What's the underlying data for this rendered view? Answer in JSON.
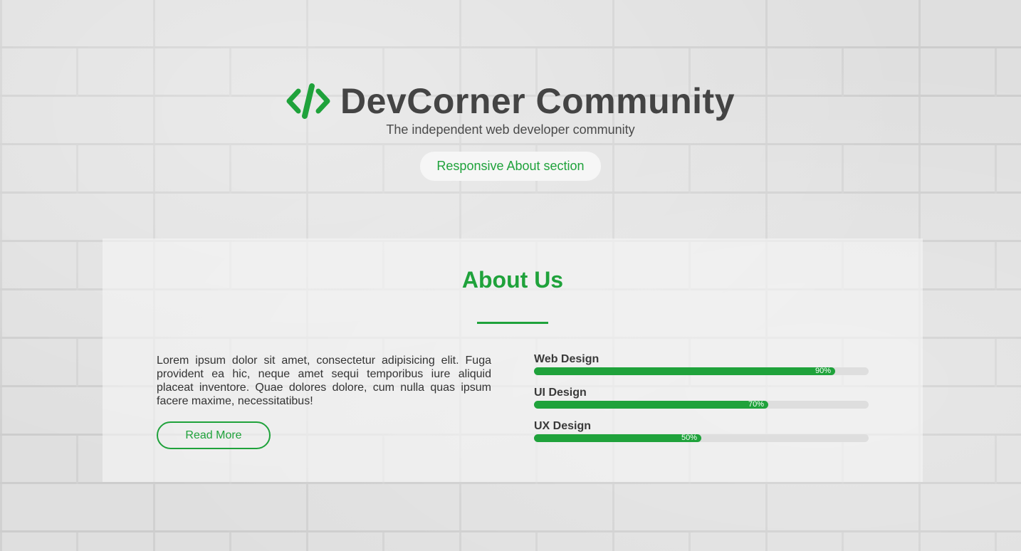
{
  "hero": {
    "title": "DevCorner Community",
    "tagline": "The independent web developer community",
    "button_label": "Responsive About section"
  },
  "about": {
    "title": "About Us",
    "text": "Lorem ipsum dolor sit amet, consectetur adipisicing elit. Fuga provident ea hic, neque amet sequi temporibus iure aliquid placeat inventore. Quae dolores dolore, cum nulla quas ipsum facere maxime, necessitatibus!",
    "read_more_label": "Read More"
  },
  "skills": [
    {
      "label": "Web Design",
      "percent": 90,
      "percent_label": "90%"
    },
    {
      "label": "UI Design",
      "percent": 70,
      "percent_label": "70%"
    },
    {
      "label": "UX Design",
      "percent": 50,
      "percent_label": "50%"
    }
  ],
  "colors": {
    "accent": "#1fa23b",
    "title_text": "#444444",
    "track": "#dedede"
  },
  "icons": {
    "brand": "code-icon"
  }
}
